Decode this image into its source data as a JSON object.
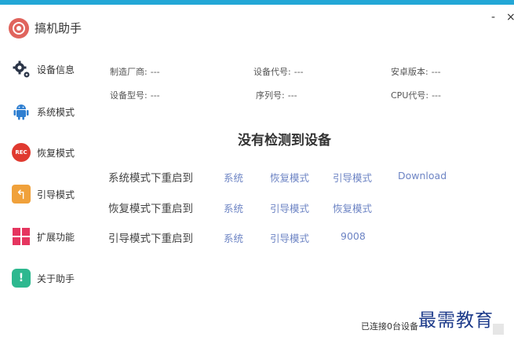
{
  "app": {
    "title": "搞机助手",
    "min_glyph": "-",
    "close_glyph": "×"
  },
  "sidebar": {
    "items": [
      {
        "label": "设备信息",
        "icon": "gear-icon"
      },
      {
        "label": "系统模式",
        "icon": "android-icon"
      },
      {
        "label": "恢复模式",
        "icon": "rec-icon"
      },
      {
        "label": "引导模式",
        "icon": "return-arrow-icon"
      },
      {
        "label": "扩展功能",
        "icon": "grid-icon"
      },
      {
        "label": "关于助手",
        "icon": "info-icon"
      }
    ],
    "rec_text": "REC",
    "info_glyph": "!",
    "arrow_glyph": "↰"
  },
  "device_info": {
    "manufacturer": {
      "label": "制造厂商:",
      "value": "---"
    },
    "device_code": {
      "label": "设备代号:",
      "value": "---"
    },
    "android_version": {
      "label": "安卓版本:",
      "value": "---"
    },
    "model": {
      "label": "设备型号:",
      "value": "---"
    },
    "serial": {
      "label": "序列号:",
      "value": "---"
    },
    "cpu_code": {
      "label": "CPU代号:",
      "value": "---"
    }
  },
  "main": {
    "no_device": "没有检测到设备",
    "reboot_rows": [
      {
        "label": "系统模式下重启到",
        "buttons": [
          "系统",
          "恢复模式",
          "引导模式",
          "Download"
        ]
      },
      {
        "label": "恢复模式下重启到",
        "buttons": [
          "系统",
          "引导模式",
          "恢复模式"
        ]
      },
      {
        "label": "引导模式下重启到",
        "buttons": [
          "系统",
          "引导模式",
          "9008"
        ]
      }
    ]
  },
  "status": {
    "connected": "已连接0台设备"
  },
  "watermark": "最需教育",
  "colors": {
    "accent": "#23a7d6",
    "link": "#6d84c4",
    "logo": "#e0645d",
    "watermark": "#1c3a8a"
  }
}
